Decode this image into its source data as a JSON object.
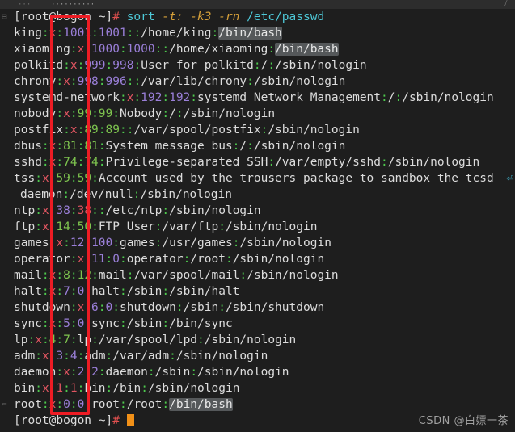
{
  "window": {
    "tab_bar": {
      "tab_left": "···",
      "tab_right": "··········",
      "corner_icon": "resize-handle-icon"
    }
  },
  "terminal": {
    "background": "#1e1e1e",
    "foreground": "#d4d4d4",
    "cursor_color": "#f29118",
    "highlight_color": "#55585a",
    "annotation_color": "#ed1c24",
    "prompt": {
      "user_host": "[root@bogon ~]",
      "symbol": "#"
    },
    "command_line": {
      "prompt": "[root@bogon ~]",
      "symbol": "#",
      "command": "sort",
      "options": [
        "-t:",
        "-k3",
        "-rn"
      ],
      "argument": "/etc/passwd",
      "full": "[root@bogon ~]# sort -t: -k3 -rn /etc/passwd"
    },
    "lines": [
      {
        "user": "king",
        "pw": "x",
        "uid": "1001",
        "gid": "1001",
        "gecos": "",
        "home": "/home/king",
        "shell": "/bin/bash",
        "uid_color": "num",
        "gid_color": "num",
        "shell_highlight": true
      },
      {
        "user": "xiaoming",
        "pw": "x",
        "uid": "1000",
        "gid": "1000",
        "gecos": "",
        "home": "/home/xiaoming",
        "shell": "/bin/bash",
        "uid_color": "num",
        "gid_color": "num",
        "shell_highlight": true
      },
      {
        "user": "polkitd",
        "pw": "x",
        "uid": "999",
        "gid": "998",
        "gecos": "User for polkitd",
        "home": "/",
        "shell": "/sbin/nologin",
        "uid_color": "num",
        "gid_color": "num",
        "shell_highlight": false
      },
      {
        "user": "chrony",
        "pw": "x",
        "uid": "998",
        "gid": "996",
        "gecos": "",
        "home": "/var/lib/chrony",
        "shell": "/sbin/nologin",
        "uid_color": "num",
        "gid_color": "num",
        "shell_highlight": false
      },
      {
        "user": "systemd-network",
        "pw": "x",
        "uid": "192",
        "gid": "192",
        "gecos": "systemd Network Management",
        "home": "/",
        "shell": "/sbin/nologin",
        "uid_color": "num",
        "gid_color": "num",
        "shell_highlight": false
      },
      {
        "user": "nobody",
        "pw": "x",
        "uid": "99",
        "gid": "99",
        "gecos": "Nobody",
        "home": "/",
        "shell": "/sbin/nologin",
        "uid_color": "numg",
        "gid_color": "numg",
        "shell_highlight": false
      },
      {
        "user": "postfix",
        "pw": "x",
        "uid": "89",
        "gid": "89",
        "gecos": "",
        "home": "/var/spool/postfix",
        "shell": "/sbin/nologin",
        "uid_color": "numg",
        "gid_color": "numg",
        "shell_highlight": false
      },
      {
        "user": "dbus",
        "pw": "x",
        "uid": "81",
        "gid": "81",
        "gecos": "System message bus",
        "home": "/",
        "shell": "/sbin/nologin",
        "uid_color": "numg",
        "gid_color": "numg",
        "shell_highlight": false
      },
      {
        "user": "sshd",
        "pw": "x",
        "uid": "74",
        "gid": "74",
        "gecos": "Privilege-separated SSH",
        "home": "/var/empty/sshd",
        "shell": "/sbin/nologin",
        "uid_color": "numg",
        "gid_color": "numg",
        "shell_highlight": false
      },
      {
        "user": "tss",
        "pw": "x",
        "uid": "59",
        "gid": "59",
        "gecos": "Account used by the trousers package to sandbox the tcsd daemon",
        "home": "/dev/null",
        "shell": "/sbin/nologin",
        "uid_color": "numg",
        "gid_color": "numg",
        "shell_highlight": false,
        "wrapped": true
      },
      {
        "user": "ntp",
        "pw": "x",
        "uid": "38",
        "gid": "38",
        "gecos": "",
        "home": "/etc/ntp",
        "shell": "/sbin/nologin",
        "uid_color": "num",
        "gid_color": "numr",
        "shell_highlight": false
      },
      {
        "user": "ftp",
        "pw": "x",
        "uid": "14",
        "gid": "50",
        "gecos": "FTP User",
        "home": "/var/ftp",
        "shell": "/sbin/nologin",
        "uid_color": "numg",
        "gid_color": "numg",
        "shell_highlight": false
      },
      {
        "user": "games",
        "pw": "x",
        "uid": "12",
        "gid": "100",
        "gecos": "games",
        "home": "/usr/games",
        "shell": "/sbin/nologin",
        "uid_color": "num",
        "gid_color": "num",
        "shell_highlight": false
      },
      {
        "user": "operator",
        "pw": "x",
        "uid": "11",
        "gid": "0",
        "gecos": "operator",
        "home": "/root",
        "shell": "/sbin/nologin",
        "uid_color": "num",
        "gid_color": "num",
        "shell_highlight": false
      },
      {
        "user": "mail",
        "pw": "x",
        "uid": "8",
        "gid": "12",
        "gecos": "mail",
        "home": "/var/spool/mail",
        "shell": "/sbin/nologin",
        "uid_color": "numg",
        "gid_color": "numg",
        "shell_highlight": false
      },
      {
        "user": "halt",
        "pw": "x",
        "uid": "7",
        "gid": "0",
        "gecos": "halt",
        "home": "/sbin",
        "shell": "/sbin/halt",
        "uid_color": "num",
        "gid_color": "num",
        "shell_highlight": false
      },
      {
        "user": "shutdown",
        "pw": "x",
        "uid": "6",
        "gid": "0",
        "gecos": "shutdown",
        "home": "/sbin",
        "shell": "/sbin/shutdown",
        "uid_color": "num",
        "gid_color": "num",
        "shell_highlight": false
      },
      {
        "user": "sync",
        "pw": "x",
        "uid": "5",
        "gid": "0",
        "gecos": "sync",
        "home": "/sbin",
        "shell": "/bin/sync",
        "uid_color": "num",
        "gid_color": "num",
        "shell_highlight": false
      },
      {
        "user": "lp",
        "pw": "x",
        "uid": "4",
        "gid": "7",
        "gecos": "lp",
        "home": "/var/spool/lpd",
        "shell": "/sbin/nologin",
        "uid_color": "numg",
        "gid_color": "numg",
        "shell_highlight": false
      },
      {
        "user": "adm",
        "pw": "x",
        "uid": "3",
        "gid": "4",
        "gecos": "adm",
        "home": "/var/adm",
        "shell": "/sbin/nologin",
        "uid_color": "num",
        "gid_color": "num",
        "shell_highlight": false
      },
      {
        "user": "daemon",
        "pw": "x",
        "uid": "2",
        "gid": "2",
        "gecos": "daemon",
        "home": "/sbin",
        "shell": "/sbin/nologin",
        "uid_color": "num",
        "gid_color": "num",
        "shell_highlight": false
      },
      {
        "user": "bin",
        "pw": "x",
        "uid": "1",
        "gid": "1",
        "gecos": "bin",
        "home": "/bin",
        "shell": "/sbin/nologin",
        "uid_color": "numr",
        "gid_color": "numr",
        "shell_highlight": false
      },
      {
        "user": "root",
        "pw": "x",
        "uid": "0",
        "gid": "0",
        "gecos": "root",
        "home": "/root",
        "shell": "/bin/bash",
        "uid_color": "num",
        "gid_color": "num",
        "shell_highlight": true
      }
    ],
    "wrap_continuation": "daemon:/dev/null:/sbin/nologin",
    "wrap_marker": "⏎"
  },
  "annotation": {
    "type": "red-rectangle",
    "color": "#ed1c24",
    "description": "highlights the third field (UID column)"
  },
  "watermark": {
    "text": "CSDN @白嫖一茶"
  }
}
